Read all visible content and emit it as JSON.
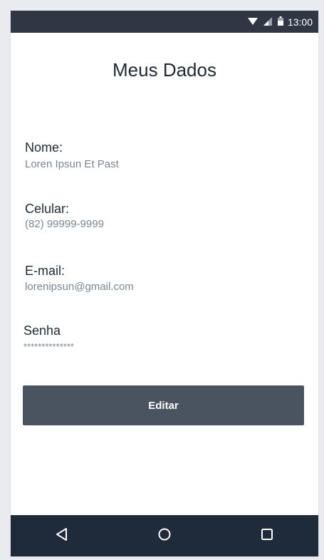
{
  "status_bar": {
    "time": "13:00",
    "icons": [
      "wifi-icon",
      "signal-icon",
      "battery-icon"
    ]
  },
  "page": {
    "title": "Meus Dados"
  },
  "fields": [
    {
      "label": "Nome:",
      "value": "Loren Ipsun Et Past"
    },
    {
      "label": "Celular:",
      "value": "(82) 99999-9999"
    },
    {
      "label": "E-mail:",
      "value": "lorenipsun@gmail.com"
    },
    {
      "label": "Senha",
      "value": "**************"
    }
  ],
  "actions": {
    "edit_label": "Editar"
  },
  "nav": {
    "icons": [
      "back-icon",
      "home-icon",
      "recents-icon"
    ]
  },
  "colors": {
    "status_bar": "#2f3744",
    "nav_bar": "#1f2a3a",
    "button": "#4a5461",
    "value_text": "#7b8694"
  }
}
